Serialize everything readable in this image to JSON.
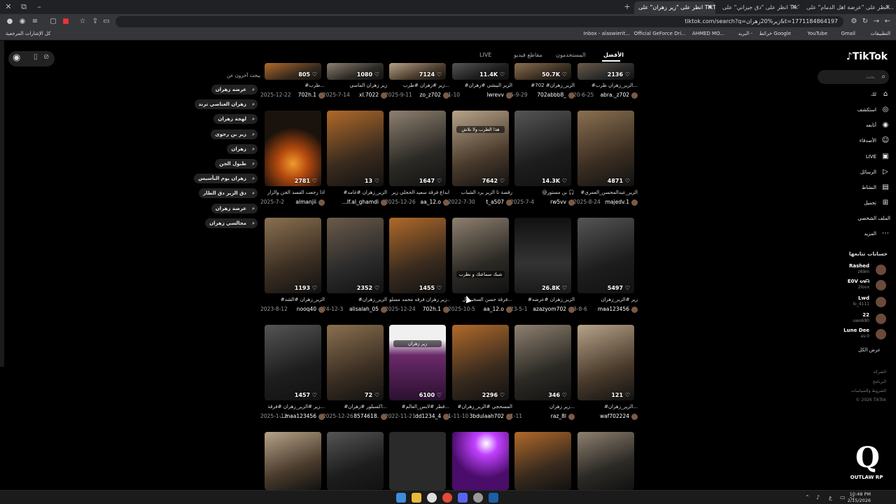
{
  "browser": {
    "tabs": [
      {
        "label": "انظر على \"عرضة اهل الدمام\" على…",
        "active": false
      },
      {
        "label": "انظر على \"دق جيزاني\" على TikTok",
        "active": false
      },
      {
        "label": "انظر على \"زير زهران\" على TikTok",
        "active": true
      }
    ],
    "new_tab": "+",
    "url": "tiktok.com/search?q=زير%20زهران&t=1771184864197",
    "bookmarks": [
      "التطبيقات",
      "Gmail",
      "YouTube",
      "خرائط Google",
      "البريد -",
      "AHMED MO...",
      "Official GeForce Dri...",
      "Inbox - alaswierit...",
      "كل الإشارات المرجعية"
    ]
  },
  "tiktok": {
    "logo": "TikTok",
    "search_placeholder": "بحث",
    "nav": [
      {
        "label": "لك",
        "icon": "home-icon"
      },
      {
        "label": "استكشف",
        "icon": "compass-icon"
      },
      {
        "label": "أتابعه",
        "icon": "following-icon"
      },
      {
        "label": "الأصدقاء",
        "icon": "friends-icon"
      },
      {
        "label": "LIVE",
        "icon": "live-icon"
      },
      {
        "label": "الرسائل",
        "icon": "messages-icon"
      },
      {
        "label": "النشاط",
        "icon": "activity-icon"
      },
      {
        "label": "تحميل",
        "icon": "upload-icon"
      },
      {
        "label": "الملف الشخصي",
        "icon": "profile-icon"
      },
      {
        "label": "المزيد",
        "icon": "more-icon"
      }
    ],
    "following_title": "حسابات تتابعها",
    "following": [
      {
        "name": "Rashed",
        "handle": "z69m"
      },
      {
        "name": "E0V ᔕᗩ",
        "handle": "2lovx"
      },
      {
        "name": "Lwd",
        "handle": "lo_4111"
      },
      {
        "name": "22",
        "handle": "uwo690"
      },
      {
        "name": "Lune Dee",
        "handle": "av.0"
      }
    ],
    "see_all": "عرض الكل",
    "footer": [
      "الشركة",
      "البرنامج",
      "الشروط والسياسات",
      "© 2026 TikTok"
    ],
    "tabs": [
      "الأفضل",
      "المستخدمون",
      "مقاطع فيديو",
      "LIVE"
    ],
    "related_title": "يبحث آخرون عن",
    "related": [
      "عرضه زهران",
      "زهران العناصي ترند",
      "لهجة زهران",
      "زير بن رجوى",
      "زهران",
      "طبول الجن",
      "زهران يوم التأسيس",
      "دق الزير دق الطار",
      "عرضة زهران",
      "مجالسي زهران"
    ]
  },
  "videos": [
    {
      "count": "2136",
      "cap": "#الزير_زهران طرب...",
      "user": "abra._z702",
      "date": "20-6-25"
    },
    {
      "count": "50.7K",
      "cap": "#702 #الزير_زهران",
      "user": "702abbb8_",
      "date": "5-9-29"
    },
    {
      "count": "11.4K",
      "cap": "#الزير البيشي #زهران",
      "user": "lwrevv",
      "date": "1-10"
    },
    {
      "count": "7124",
      "cap": "زير #زهران #طرب...",
      "user": "zo_z702",
      "date": "2025-9-11"
    },
    {
      "count": "1080",
      "cap": "زير زهران الماسي",
      "user": "xl.7022",
      "date": "2025-7-14"
    },
    {
      "count": "805",
      "cap": "#طرب...",
      "user": "702h.1",
      "date": "2025-12-22"
    },
    {
      "count": "4871",
      "cap": "#الزير_عبدالمحسن_العمري",
      "user": "majedv.1",
      "date": "2025-8-24"
    },
    {
      "count": "14.3K",
      "cap": "@بن مستور 🎧",
      "user": "rw5vv",
      "date": "2025-7-4"
    },
    {
      "count": "7642",
      "cap": "رقصة تا الزير يرد الشباب",
      "user": "t_a507",
      "date": "2022-7-30",
      "overlay": "هذا الطرب ولا بلاش"
    },
    {
      "count": "1647",
      "cap": "ابداع فرقة سعيد الحجلي زير",
      "user": "aa_12.o",
      "date": "2025-12-26"
    },
    {
      "count": "13",
      "cap": "#الزير_زهران #غامد",
      "user": "...lf.al_ghamdi",
      "date": ""
    },
    {
      "count": "2781",
      "cap": "اذا رجعت الفسد الجن والزار",
      "user": "almanjii",
      "date": "2025-7-2"
    },
    {
      "count": "5497",
      "cap": "زير #الزير_زهران",
      "user": "maa123456",
      "date": "3-8-6"
    },
    {
      "count": "26.8K",
      "cap": "#الزير_زهران #عرضه",
      "user": "azazyom702",
      "date": "23-5-1"
    },
    {
      "count": "",
      "cap": "فرقة حسن السخبر آل...",
      "user": "aa_12.o",
      "date": "2025-10-5",
      "overlay": "شبك سماعتك و نطرب"
    },
    {
      "count": "1455",
      "cap": "زير زهران فرقه محمد مسلو...",
      "user": "702h.1",
      "date": "2025-12-24"
    },
    {
      "count": "2352",
      "cap": "#الزير_زهران",
      "user": "alisalah_05",
      "date": "24-12-3"
    },
    {
      "count": "1193",
      "cap": "#الزير_زهران #الشد",
      "user": "nooq40",
      "date": "2023-8-12"
    },
    {
      "count": "121",
      "cap": "#الزير_زهران...",
      "user": "waf702224",
      "date": ""
    },
    {
      "count": "346",
      "cap": "زير زهران...",
      "user": "raz_8l",
      "date": "1-11"
    },
    {
      "count": "2296",
      "cap": "#المسحجي #الزير_زهران",
      "user": "3bdulaah702",
      "date": "1-11-10"
    },
    {
      "count": "6100",
      "cap": "#قطر #لابس_العالم...",
      "user": "dd1234_4",
      "date": "2022-11-21",
      "overlay": "زير زهران"
    },
    {
      "count": "72",
      "cap": "#اكسبلور #زهران...",
      "user": "8574618.",
      "date": "2025-12-26"
    },
    {
      "count": "1457",
      "cap": "زير #الزير_زهران #فرقة...",
      "user": "...maa123456",
      "date": "2025-1-12"
    },
    {
      "count": "",
      "cap": "",
      "user": "",
      "date": ""
    },
    {
      "count": "",
      "cap": "",
      "user": "",
      "date": ""
    },
    {
      "count": "",
      "cap": "",
      "user": "",
      "date": ""
    },
    {
      "count": "",
      "cap": "",
      "user": "",
      "date": ""
    },
    {
      "count": "",
      "cap": "",
      "user": "",
      "date": ""
    },
    {
      "count": "",
      "cap": "",
      "user": "",
      "date": ""
    }
  ],
  "taskbar": {
    "time": "10:48 PM",
    "date": "2/15/2026",
    "lang": "ع"
  },
  "watermark": "OUTLAW RP"
}
